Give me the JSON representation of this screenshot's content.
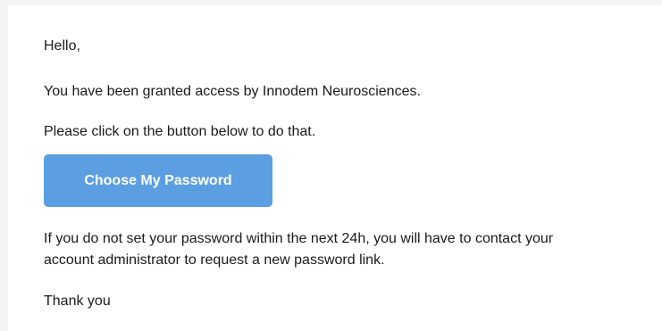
{
  "email": {
    "greeting": "Hello,",
    "granted_text": "You have been granted access by Innodem Neurosciences.",
    "instruction_text": "Please click on the button below to do that.",
    "cta_label": "Choose My Password",
    "notice_line1": "If you do not set your password within the next 24h, you will have to contact your",
    "notice_line2": "account administrator to request a new password link.",
    "closing": "Thank you"
  },
  "colors": {
    "button_background": "#5b9ee1",
    "button_text": "#ffffff",
    "body_text": "#1a1a1a",
    "page_background": "#f4f4f4"
  }
}
